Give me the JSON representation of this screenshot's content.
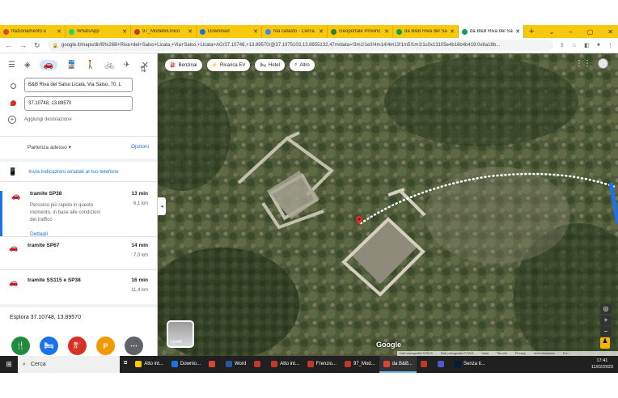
{
  "tabs": [
    {
      "title": "frazionamento e",
      "color": "#db4437"
    },
    {
      "title": "WhatsApp",
      "color": "#25d366"
    },
    {
      "title": "97_ModelloUnico",
      "color": "#c0392b"
    },
    {
      "title": "Download",
      "color": "#1a73e8"
    },
    {
      "title": "foa catasto - Cerca",
      "color": "#4285f4"
    },
    {
      "title": "Geoportale Provinc",
      "color": "#2e7d32"
    },
    {
      "title": "da B&B Riva del Sa",
      "color": "#0f9d58"
    },
    {
      "title": "da B&B Riva del Sa",
      "color": "#0f9d58",
      "active": true
    }
  ],
  "url": "google.it/maps/dir/B%26B+Riva+del+Salso+Licata,+Via+Salso,+Licata+AG/37.10748,+13.89570/@37.1075103,13.8955132,47m/data=!3m1!1e3!4m14!4m13!1m5!1m1!1s0x13105e4b16b4b419:0x6a18b...",
  "directions": {
    "origin": "B&B Riva del Salso Licata, Via Salso, 70, L",
    "destination": "37.10748, 13.89570",
    "add_destination": "Aggiungi destinazione",
    "depart_now": "Partenza adesso",
    "options": "Opzioni",
    "send_to_phone": "Invia indicazioni stradali al tuo telefono",
    "routes": [
      {
        "name": "tramite SP38",
        "time": "13 min",
        "distance": "6,1 km",
        "desc": "Percorso più rapido in questo momento, in base alle condizioni del traffico",
        "details": "Dettagli"
      },
      {
        "name": "tramite SP67",
        "time": "14 min",
        "distance": "7,0 km"
      },
      {
        "name": "tramite SS115 e SP38",
        "time": "16 min",
        "distance": "11,4 km"
      }
    ],
    "explore": "Esplora 37.10748, 13.89570",
    "categories": [
      {
        "icon": "restaurant-icon",
        "glyph": "🍴",
        "color": "#1e8e3e"
      },
      {
        "icon": "hotel-icon",
        "glyph": "🛏",
        "color": "#1a73e8"
      },
      {
        "icon": "gas-station-icon",
        "glyph": "⛽",
        "color": "#d93025"
      },
      {
        "icon": "parking-icon",
        "glyph": "P",
        "color": "#f29900"
      },
      {
        "icon": "more-icon",
        "glyph": "⋯",
        "color": "#5f6368"
      }
    ]
  },
  "map": {
    "chips": [
      {
        "label": "Benzinai",
        "icon": "gas-station-icon",
        "glyph": "⛽"
      },
      {
        "label": "Ricarica EV",
        "icon": "ev-charger-icon",
        "glyph": "⚡"
      },
      {
        "label": "Hotel",
        "icon": "hotel-icon",
        "glyph": "🛏"
      },
      {
        "label": "Altro",
        "icon": "search-icon",
        "glyph": "⌕"
      }
    ],
    "layers_label": "Livelli",
    "logo": "Google",
    "attribution": [
      "Dati cartografici ©2023",
      "Dati cartografici ©2023",
      "Italia",
      "Termini",
      "Privacy",
      "Invia feedback",
      "5 m"
    ]
  },
  "taskbar": {
    "search": "Cerca",
    "items": [
      {
        "label": "Atto int...",
        "color": "#f6c90e"
      },
      {
        "label": "Downlo...",
        "color": "#1a73e8"
      },
      {
        "label": "",
        "color": "#db4437"
      },
      {
        "label": "Word",
        "color": "#2b579a"
      },
      {
        "label": "",
        "color": "#c0392b"
      },
      {
        "label": "Atto int...",
        "color": "#c0392b"
      },
      {
        "label": "Frenzio...",
        "color": "#c0392b"
      },
      {
        "label": "97_Mod...",
        "color": "#c0392b"
      },
      {
        "label": "da B&B...",
        "color": "#db4437",
        "open": true
      },
      {
        "label": "",
        "color": "#c0392b"
      },
      {
        "label": "",
        "color": "#5059c9"
      },
      {
        "label": "Senza ti...",
        "color": "#001e36"
      }
    ],
    "time": "17:41",
    "date": "11/02/2023"
  }
}
